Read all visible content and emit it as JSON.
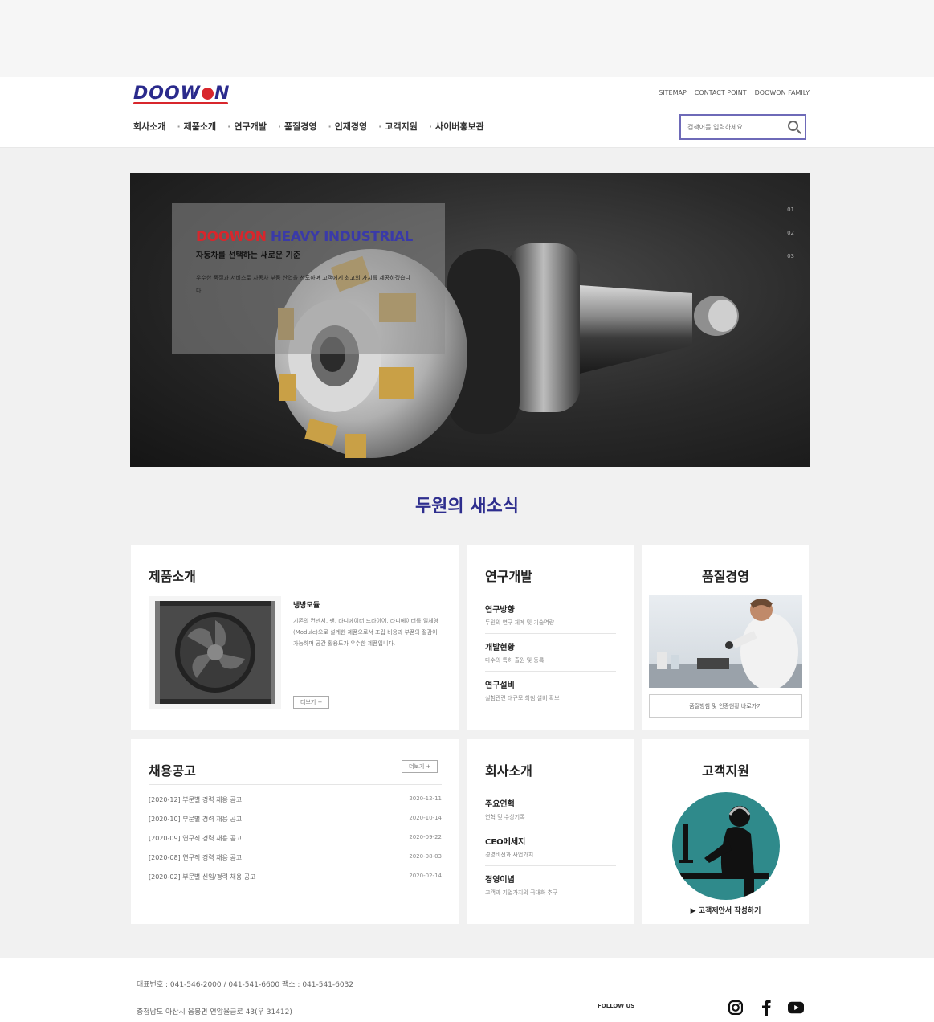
{
  "header": {
    "logo_text": "DOOW",
    "logo_text_end": "N",
    "util_links": [
      "SITEMAP",
      "CONTACT POINT",
      "DOOWON FAMILY"
    ],
    "nav": [
      "회사소개",
      "제품소개",
      "연구개발",
      "품질경영",
      "인재경영",
      "고객지원",
      "사이버홍보관"
    ],
    "search_placeholder": "검색어를 입력하세요"
  },
  "hero": {
    "title_red": "DOOWON",
    "title_blue": " HEAVY INDUSTRIAL",
    "subtitle": "자동차를 선택하는 새로운 기준",
    "description": "우수한 품질과 서비스로 자동차 부품 산업을 선도하며 고객에게 최고의 가치를 제공하겠습니다.",
    "pager": [
      "01",
      "02",
      "03"
    ]
  },
  "section_title": "두원의 새소식",
  "products": {
    "title": "제품소개",
    "name": "냉방모듈",
    "description": "기존의 컨덴서, 팬, 라디에이터 드라이어, 라디에이터를 일체형(Module)으로 설계한 제품으로서 조립 비용과 부품의 절감이 가능하며 공간 활용도가 우수한 제품입니다.",
    "more_label": "더보기 +"
  },
  "rnd": {
    "title": "연구개발",
    "items": [
      {
        "title": "연구방향",
        "sub": "두원의 연구 체계 및 기술역량"
      },
      {
        "title": "개발현황",
        "sub": "다수의 특허 출원 및 등록"
      },
      {
        "title": "연구설비",
        "sub": "실험관련 대규모 최첨 설비 확보"
      }
    ]
  },
  "quality": {
    "title": "품질경영",
    "button_label": "품질방침 및 인증현황 바로가기"
  },
  "jobs": {
    "title": "채용공고",
    "more_label": "더보기 +",
    "rows": [
      {
        "title": "[2020-12] 부문별 경력 채용 공고",
        "date": "2020-12-11"
      },
      {
        "title": "[2020-10] 부문별 경력 채용 공고",
        "date": "2020-10-14"
      },
      {
        "title": "[2020-09] 연구직 경력 채용 공고",
        "date": "2020-09-22"
      },
      {
        "title": "[2020-08] 연구직 경력 채용 공고",
        "date": "2020-08-03"
      },
      {
        "title": "[2020-02] 부문별 신입/경력 채용 공고",
        "date": "2020-02-14"
      }
    ]
  },
  "about": {
    "title": "회사소개",
    "items": [
      {
        "title": "주요연혁",
        "sub": "연혁 및 수상기록"
      },
      {
        "title": "CEO메세지",
        "sub": "경영비전과 사업가치"
      },
      {
        "title": "경영이념",
        "sub": "고객과 기업가치의 극대화 추구"
      }
    ]
  },
  "support": {
    "title": "고객지원",
    "link_label": "▶ 고객제안서 작성하기"
  },
  "footer": {
    "contact": "대표번호 : 041-546-2000 / 041-541-6600  팩스 : 041-541-6032",
    "address": "충청남도 아산시 음봉면 연암율금로 43(우 31412)",
    "follow_label": "FOLLOW US"
  },
  "colors": {
    "brand_blue": "#2e2e8e",
    "brand_red": "#d8262c",
    "support_teal": "#2f8a8b"
  }
}
